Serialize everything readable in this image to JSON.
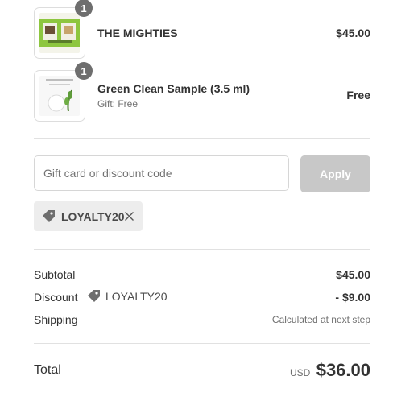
{
  "line_items": [
    {
      "quantity": "1",
      "name": "THE MIGHTIES",
      "subtitle": "",
      "price": "$45.00",
      "image_icon": "mighties-product-image"
    },
    {
      "quantity": "1",
      "name": "Green Clean Sample (3.5 ml)",
      "subtitle": "Gift: Free",
      "price": "Free",
      "image_icon": "green-clean-product-image"
    }
  ],
  "discount": {
    "placeholder": "Gift card or discount code",
    "value": "",
    "apply_label": "Apply",
    "applied_code": "LOYALTY20",
    "tag_icon": "tag-icon",
    "remove_icon": "close-icon"
  },
  "summary": {
    "subtotal_label": "Subtotal",
    "subtotal_value": "$45.00",
    "discount_label": "Discount",
    "discount_code": "LOYALTY20",
    "discount_value": "- $9.00",
    "shipping_label": "Shipping",
    "shipping_value": "Calculated at next step",
    "total_label": "Total",
    "currency": "USD",
    "total_value": "$36.00"
  },
  "colors": {
    "badge": "#6e6e6e",
    "apply_button_disabled": "#c8c8c8",
    "chip_background": "#ededed",
    "divider": "#e1e1e1"
  }
}
